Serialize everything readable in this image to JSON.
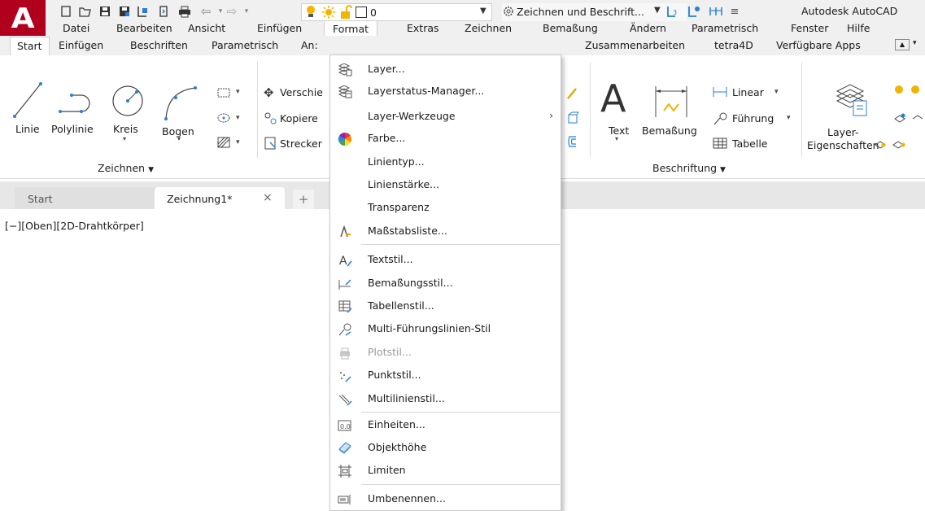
{
  "titlebar": {
    "logo_letter": "A",
    "layer_value": "0",
    "workspace_value": "Zeichnen und Beschrift...",
    "app_title": "Autodesk AutoCAD"
  },
  "menubar": {
    "items": [
      "Datei",
      "Bearbeiten",
      "Ansicht",
      "Einfügen",
      "Format",
      "Extras",
      "Zeichnen",
      "Bemaßung",
      "Ändern",
      "Parametrisch",
      "Fenster",
      "Hilfe"
    ]
  },
  "ribbon_tabs": {
    "items": [
      "Start",
      "Einfügen",
      "Beschriften",
      "Parametrisch",
      "An:",
      "Zusammenarbeiten",
      "tetra4D",
      "Verfügbare Apps"
    ]
  },
  "ribbon": {
    "draw_tools": [
      "Linie",
      "Polylinie",
      "Kreis",
      "Bogen"
    ],
    "modify_tools": [
      "Verschie",
      "Kopiere",
      "Strecker"
    ],
    "annotation": {
      "text": "Text",
      "dimension": "Bemaßung",
      "linear": "Linear",
      "leader": "Führung",
      "table": "Tabelle"
    },
    "layer_props_line1": "Layer-",
    "layer_props_line2": "Eigenschaften",
    "panel_draw": "Zeichnen",
    "panel_annotation": "Beschriftung"
  },
  "filetabs": {
    "start": "Start",
    "drawing": "Zeichnung1*",
    "close": "×",
    "new": "+"
  },
  "viewport": {
    "label": "[−][Oben][2D-Drahtkörper]"
  },
  "format_menu": {
    "items": [
      {
        "label": "Layer...",
        "icon": "layer-icon"
      },
      {
        "label": "Layerstatus-Manager...",
        "icon": "layer-state-icon"
      },
      {
        "label": "Layer-Werkzeuge",
        "icon": "",
        "submenu": true
      },
      {
        "label": "Farbe...",
        "icon": "color-wheel-icon"
      },
      {
        "label": "Linientyp...",
        "icon": ""
      },
      {
        "label": "Linienstärke...",
        "icon": ""
      },
      {
        "label": "Transparenz",
        "icon": ""
      },
      {
        "label": "Maßstabsliste...",
        "icon": "scale-list-icon"
      },
      {
        "label": "Textstil...",
        "icon": "text-style-icon"
      },
      {
        "label": "Bemaßungsstil...",
        "icon": "dim-style-icon"
      },
      {
        "label": "Tabellenstil...",
        "icon": "table-style-icon"
      },
      {
        "label": "Multi-Führungslinien-Stil",
        "icon": "mleader-style-icon"
      },
      {
        "label": "Plotstil...",
        "icon": "plot-style-icon",
        "disabled": true
      },
      {
        "label": "Punktstil...",
        "icon": "point-style-icon"
      },
      {
        "label": "Multilinienstil...",
        "icon": "mline-style-icon"
      },
      {
        "label": "Einheiten...",
        "icon": "units-icon"
      },
      {
        "label": "Objekthöhe",
        "icon": "thickness-icon"
      },
      {
        "label": "Limiten",
        "icon": "limits-icon"
      },
      {
        "label": "Umbenennen...",
        "icon": "rename-icon"
      }
    ]
  },
  "colors": {
    "logo": "#b0001e",
    "menu_bg": "#ffffff",
    "chrome": "#f0f0f0"
  }
}
